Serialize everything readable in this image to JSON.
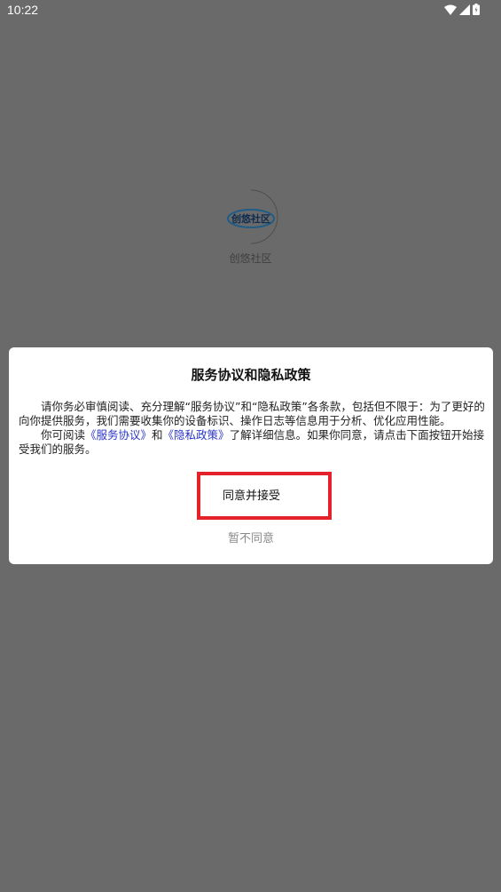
{
  "status_bar": {
    "time": "10:22",
    "icons": [
      "wifi-icon",
      "signal-icon",
      "battery-icon"
    ]
  },
  "splash": {
    "logo_text": "创悠社区",
    "app_name": "创悠社区"
  },
  "dialog": {
    "title": "服务协议和隐私政策",
    "paragraph1": "请你务必审慎阅读、充分理解“服务协议”和“隐私政策”各条款，包括但不限于：为了更好的向你提供服务，我们需要收集你的设备标识、操作日志等信息用于分析、优化应用性能。",
    "paragraph2_pre": "你可阅读",
    "service_link": "《服务协议》",
    "and": "和",
    "privacy_link": "《隐私政策》",
    "paragraph2_post": "了解详细信息。如果你同意，请点击下面按钮开始接受我们的服务。",
    "agree_label": "同意并接受",
    "disagree_label": "暂不同意"
  },
  "colors": {
    "overlay": "#6a6a6a",
    "link": "#2a36c8",
    "highlight_border": "#e5212c"
  }
}
